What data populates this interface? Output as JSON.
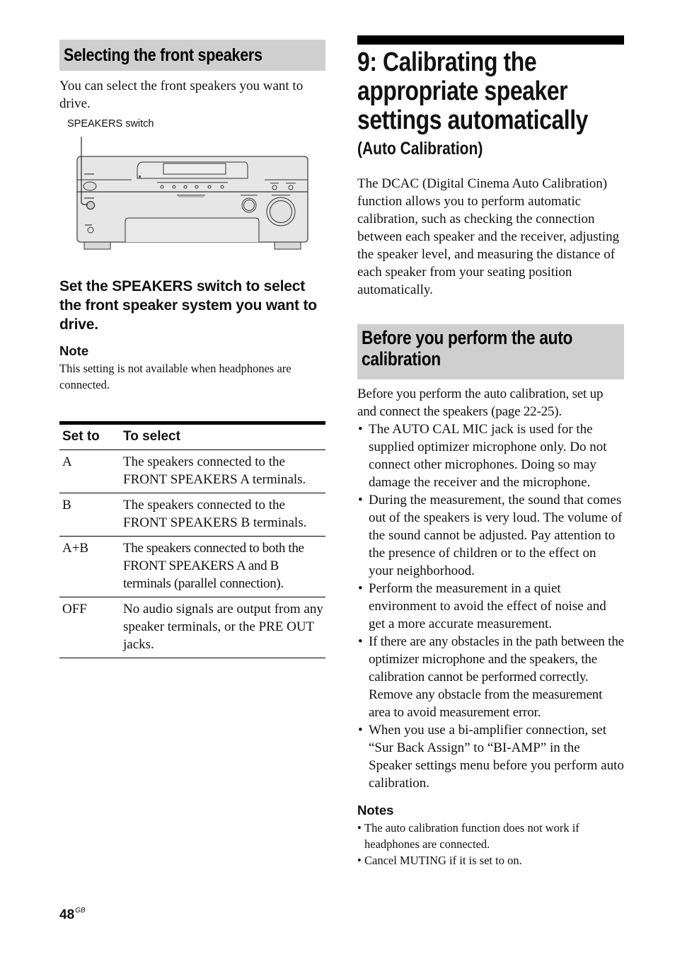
{
  "left": {
    "section_heading": "Selecting the front speakers",
    "intro": "You can select the front speakers you want to drive.",
    "figure": {
      "callout_label": "SPEAKERS switch",
      "illustration": "receiver-front-panel"
    },
    "step_heading": "Set the SPEAKERS switch to select the front speaker system you want to drive.",
    "note": {
      "heading": "Note",
      "body": "This setting is not available when headphones are connected."
    },
    "table": {
      "headers": [
        "Set to",
        "To select"
      ],
      "rows": [
        [
          "A",
          "The speakers connected to the FRONT SPEAKERS A terminals."
        ],
        [
          "B",
          "The speakers connected to the FRONT SPEAKERS B terminals."
        ],
        [
          "A+B",
          "The speakers connected to both the FRONT SPEAKERS A and B terminals (parallel connection)."
        ],
        [
          "OFF",
          "No audio signals are output from any speaker terminals, or the PRE OUT jacks."
        ]
      ]
    }
  },
  "right": {
    "title_lines": [
      "9: Calibrating the",
      "appropriate speaker",
      "settings automatically"
    ],
    "subtitle": "(Auto Calibration)",
    "dcac_paragraph": "The DCAC (Digital Cinema Auto Calibration) function allows you to perform automatic calibration, such as checking the connection between each speaker and the receiver, adjusting the speaker level, and measuring the distance of each speaker from your seating position automatically.",
    "section_heading_lines": [
      "Before you perform the auto",
      "calibration"
    ],
    "before_paragraph": "Before you perform the auto calibration, set up and connect the speakers (page 22-25).",
    "bullet_glyph": "•",
    "bullets": [
      "The AUTO CAL MIC jack is used for the supplied optimizer microphone only. Do not connect other microphones. Doing so may damage the receiver and the microphone.",
      "During the measurement, the sound that comes out of the speakers is very loud. The volume of the sound cannot be adjusted. Pay attention to the presence of children or to the effect on your neighborhood.",
      "Perform the measurement in a quiet environment to avoid the effect of noise and get a more accurate measurement.",
      "If there are any obstacles in the path between the optimizer microphone and the speakers, the calibration cannot be performed correctly. Remove any obstacle from the measurement area to avoid measurement error.",
      "When you use a bi-amplifier connection, set “Sur Back Assign” to “BI-AMP” in the Speaker settings menu before you perform auto calibration."
    ],
    "notes": {
      "heading": "Notes",
      "items": [
        "The auto calibration function does not work if headphones are connected.",
        "Cancel MUTING if it is set to on."
      ]
    }
  },
  "footer": {
    "page_number": "48",
    "region_code": "GB"
  }
}
